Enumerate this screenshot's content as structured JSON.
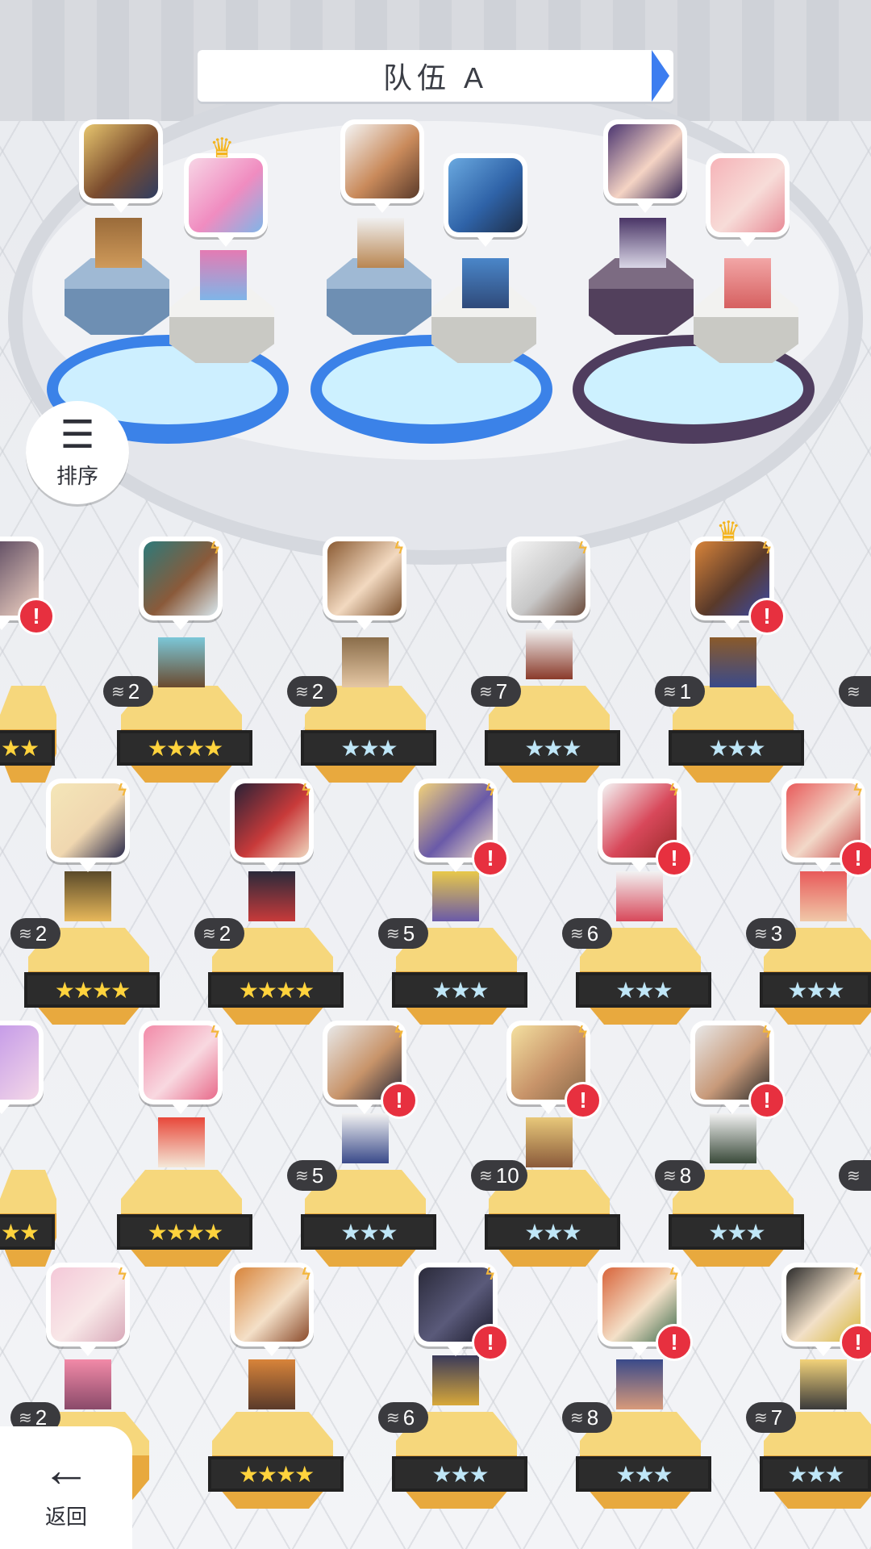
{
  "team": {
    "title": "队伍 A"
  },
  "buttons": {
    "sort_label": "排序",
    "back_label": "返回"
  },
  "colors": {
    "accent": "#3c7df0",
    "alert": "#e7303f",
    "gold_star": "#ffd33d",
    "silver_star": "#bfe6f7"
  },
  "roster": {
    "row1": [
      {
        "level": "2",
        "stars": "★★★★",
        "rarity": "gold",
        "alert": false
      },
      {
        "level": "2",
        "stars": "★★★",
        "rarity": "silver",
        "alert": false
      },
      {
        "level": "7",
        "stars": "★★★",
        "rarity": "silver",
        "alert": false
      },
      {
        "level": "1",
        "stars": "★★★",
        "rarity": "silver",
        "alert": true
      }
    ],
    "row2": [
      {
        "level": "2",
        "stars": "★★★★",
        "rarity": "gold",
        "alert": false
      },
      {
        "level": "2",
        "stars": "★★★★",
        "rarity": "gold",
        "alert": false
      },
      {
        "level": "5",
        "stars": "★★★",
        "rarity": "silver",
        "alert": true
      },
      {
        "level": "6",
        "stars": "★★★",
        "rarity": "silver",
        "alert": true
      },
      {
        "level": "3",
        "stars": "★★★",
        "rarity": "silver",
        "alert": true
      }
    ],
    "row3": [
      {
        "level": "",
        "stars": "★★★★",
        "rarity": "gold",
        "alert": false
      },
      {
        "level": "5",
        "stars": "★★★",
        "rarity": "silver",
        "alert": true
      },
      {
        "level": "10",
        "stars": "★★★",
        "rarity": "silver",
        "alert": true
      },
      {
        "level": "8",
        "stars": "★★★",
        "rarity": "silver",
        "alert": true
      }
    ],
    "row4": [
      {
        "level": "2",
        "stars": "",
        "rarity": "gold",
        "alert": false
      },
      {
        "level": "",
        "stars": "★★★★",
        "rarity": "gold",
        "alert": false
      },
      {
        "level": "6",
        "stars": "★★★",
        "rarity": "silver",
        "alert": true
      },
      {
        "level": "8",
        "stars": "★★★",
        "rarity": "silver",
        "alert": true
      },
      {
        "level": "7",
        "stars": "★★★",
        "rarity": "silver",
        "alert": true
      }
    ]
  },
  "edge_labels": {
    "left_stars_row1": "★★",
    "left_stars_row3": "★★"
  }
}
